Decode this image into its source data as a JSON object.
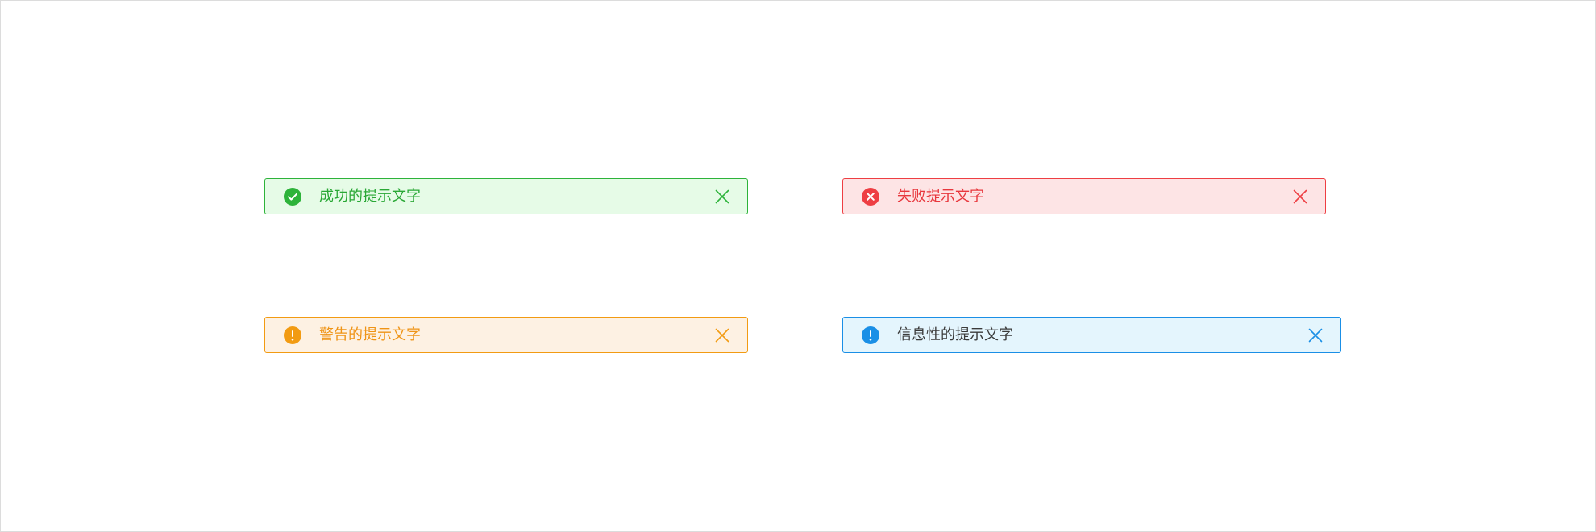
{
  "alerts": {
    "success": {
      "message": "成功的提示文字",
      "icon": "check-circle-icon",
      "close_icon": "close-icon",
      "color": "#2db33a",
      "background": "#e6fbe7"
    },
    "error": {
      "message": "失败提示文字",
      "icon": "x-circle-icon",
      "close_icon": "close-icon",
      "color": "#ee3e43",
      "background": "#fde4e5"
    },
    "warning": {
      "message": "警告的提示文字",
      "icon": "exclamation-circle-icon",
      "close_icon": "close-icon",
      "color": "#f29b12",
      "background": "#fdf1e3"
    },
    "info": {
      "message": "信息性的提示文字",
      "icon": "info-circle-icon",
      "close_icon": "close-icon",
      "color": "#1a8fe6",
      "background": "#e4f5fd"
    }
  }
}
